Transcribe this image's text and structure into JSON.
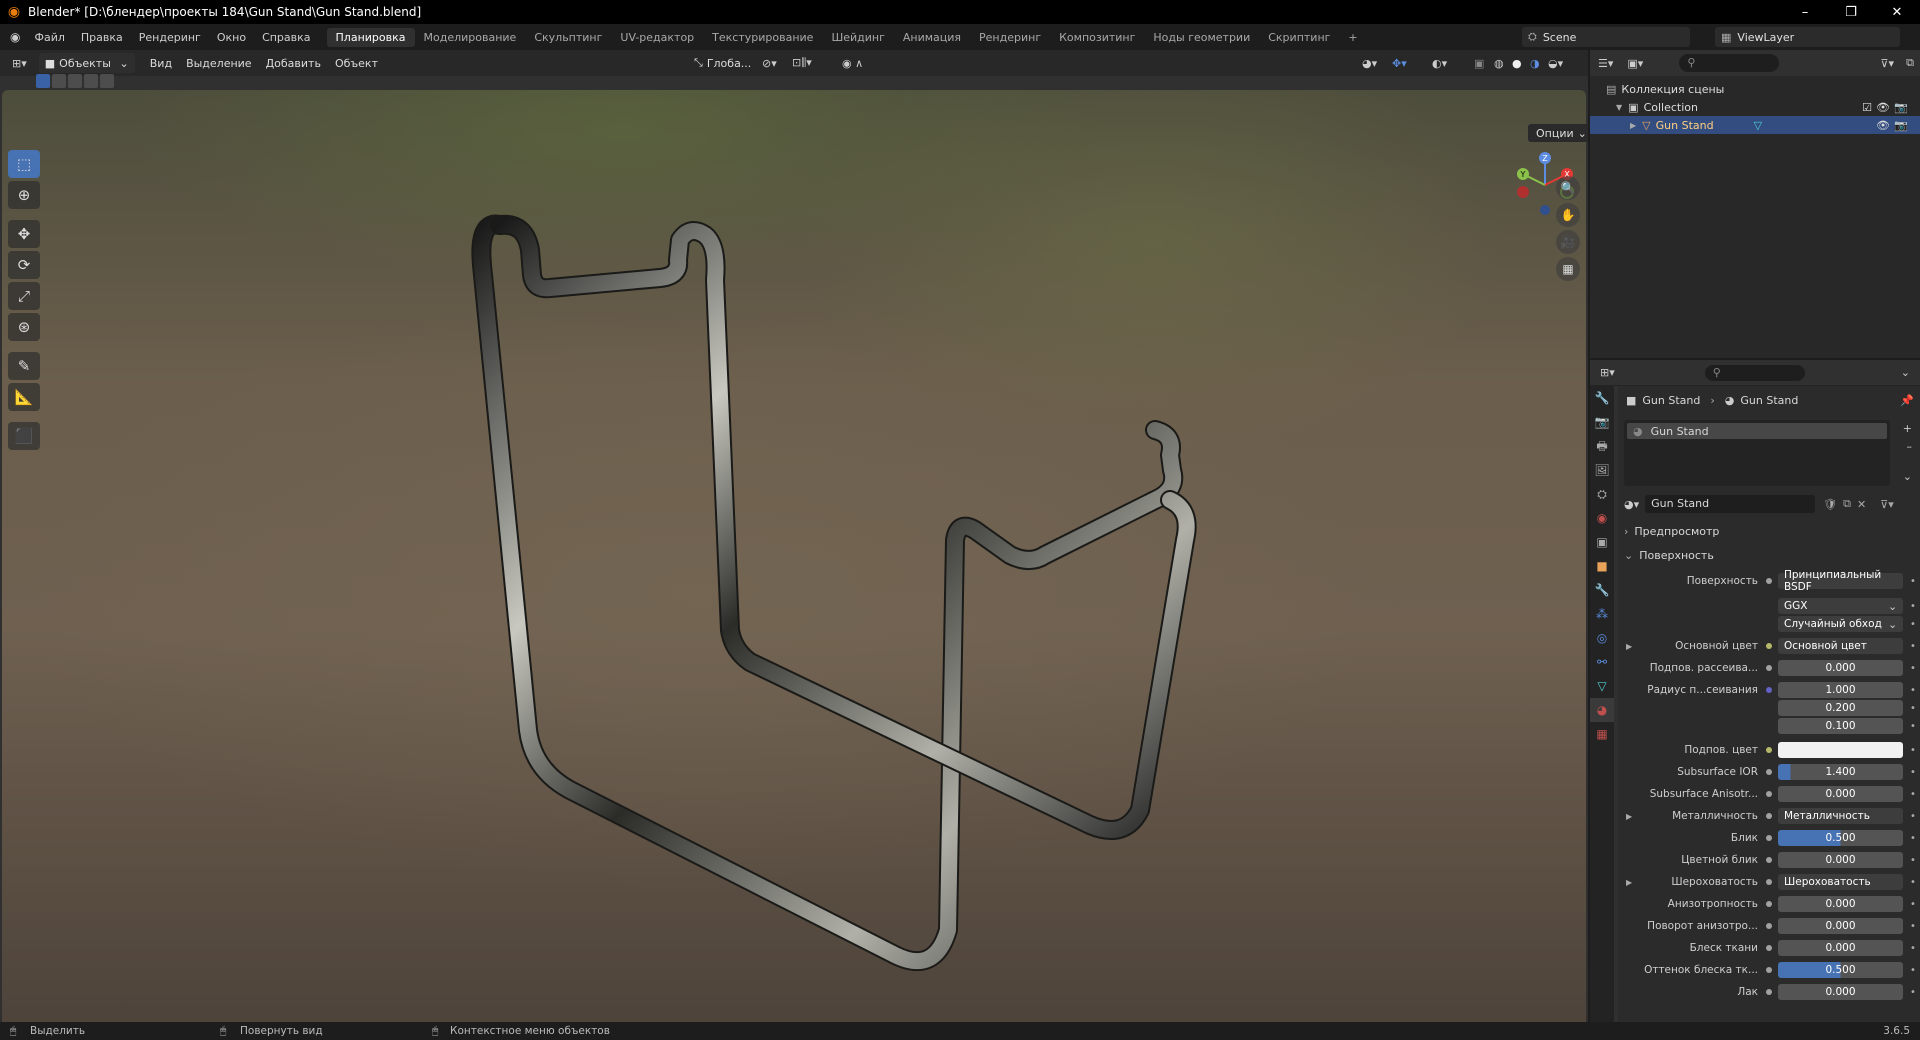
{
  "window": {
    "title": "Blender* [D:\\блендер\\проекты 184\\Gun Stand\\Gun Stand.blend]",
    "buttons": [
      "–",
      "❐",
      "✕"
    ]
  },
  "menu": [
    "Файл",
    "Правка",
    "Рендеринг",
    "Окно",
    "Справка"
  ],
  "tabs": [
    "Планировка",
    "Моделирование",
    "Скульптинг",
    "UV-редактор",
    "Текстурирование",
    "Шейдинг",
    "Анимация",
    "Рендеринг",
    "Композитинг",
    "Ноды геометрии",
    "Скриптинг",
    "+"
  ],
  "active_tab": "Планировка",
  "scene": "Scene",
  "view_layer": "ViewLayer",
  "viewport": {
    "mode": "Объекты",
    "menu": [
      "Вид",
      "Выделение",
      "Добавить",
      "Объект"
    ],
    "transform": "Глоба...",
    "options": "Опции",
    "axis_labels": {
      "z": "Z",
      "y": "Y",
      "x": "X"
    }
  },
  "outliner": {
    "scene_collection": "Коллекция сцены",
    "collection": "Collection",
    "object": "Gun Stand"
  },
  "properties": {
    "breadcrumb_object": "Gun Stand",
    "breadcrumb_material": "Gun Stand",
    "slot": "Gun Stand",
    "material_name": "Gun Stand",
    "panel_preview": "Предпросмотр",
    "panel_surface": "Поверхность",
    "fields": [
      {
        "label": "Поверхность",
        "value": "Принципиальный BSDF",
        "type": "dark",
        "dot": "g"
      },
      {
        "label": "",
        "value": "GGX",
        "type": "dark",
        "dot": "",
        "dropdown": true
      },
      {
        "label": "",
        "value": "Случайный обход",
        "type": "dark",
        "dot": "",
        "dropdown": true
      },
      {
        "label": "Основной цвет",
        "value": "Основной цвет",
        "type": "dark",
        "dot": "y",
        "expander": true
      },
      {
        "label": "Подпов. рассеива...",
        "value": "0.000",
        "type": "num",
        "dot": "g"
      },
      {
        "label": "Радиус п...сеивания",
        "value": "1.000",
        "type": "num",
        "dot": "b"
      },
      {
        "label": "",
        "value": "0.200",
        "type": "num",
        "dot": ""
      },
      {
        "label": "",
        "value": "0.100",
        "type": "num",
        "dot": ""
      },
      {
        "label": "Подпов. цвет",
        "value": "",
        "type": "white",
        "dot": "y"
      },
      {
        "label": "Subsurface IOR",
        "value": "1.400",
        "type": "blue",
        "pct": "10%",
        "dot": "g"
      },
      {
        "label": "Subsurface Anisotr...",
        "value": "0.000",
        "type": "num",
        "dot": "g"
      },
      {
        "label": "Металличность",
        "value": "Металличность",
        "type": "dark",
        "dot": "g",
        "expander": true
      },
      {
        "label": "Блик",
        "value": "0.500",
        "type": "blue",
        "pct": "50%",
        "dot": "g"
      },
      {
        "label": "Цветной блик",
        "value": "0.000",
        "type": "num",
        "dot": "g"
      },
      {
        "label": "Шероховатость",
        "value": "Шероховатость",
        "type": "dark",
        "dot": "g",
        "expander": true
      },
      {
        "label": "Анизотропность",
        "value": "0.000",
        "type": "num",
        "dot": "g"
      },
      {
        "label": "Поворот анизотро...",
        "value": "0.000",
        "type": "num",
        "dot": "g"
      },
      {
        "label": "Блеск ткани",
        "value": "0.000",
        "type": "num",
        "dot": "g"
      },
      {
        "label": "Оттенок блеска тк...",
        "value": "0.500",
        "type": "blue",
        "pct": "50%",
        "dot": "g"
      },
      {
        "label": "Лак",
        "value": "0.000",
        "type": "num",
        "dot": "g"
      }
    ]
  },
  "status": {
    "select": "Выделить",
    "rotate": "Повернуть вид",
    "context": "Контекстное меню объектов",
    "version": "3.6.5"
  }
}
